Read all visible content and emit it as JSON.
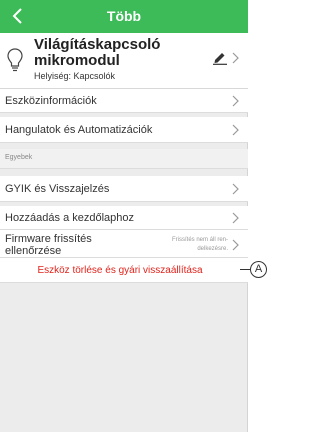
{
  "header": {
    "title": "Több",
    "back_icon": "chevron-left-icon"
  },
  "device": {
    "name": "Világításkapcsoló mikromodul",
    "location": "Helyiség: Kapcsolók",
    "icon": "lightbulb-icon",
    "edit_icon": "pencil-icon"
  },
  "menu": {
    "device_info": "Eszközinformációk",
    "scenes": "Hangulatok és Automatizációk",
    "section_other": "Egyebek",
    "faq": "GYIK és Visszajelzés",
    "add_home": "Hozzáadás a kezdőlaphoz",
    "firmware": "Firmware frissítés ellenőrzése",
    "firmware_hint": "Frissítés nem áll ren-delkezésre.",
    "delete": "Eszköz törlése és gyári visszaállítása"
  },
  "callout": {
    "letter": "A"
  },
  "colors": {
    "accent": "#3dbb58",
    "danger": "#e0231b"
  }
}
